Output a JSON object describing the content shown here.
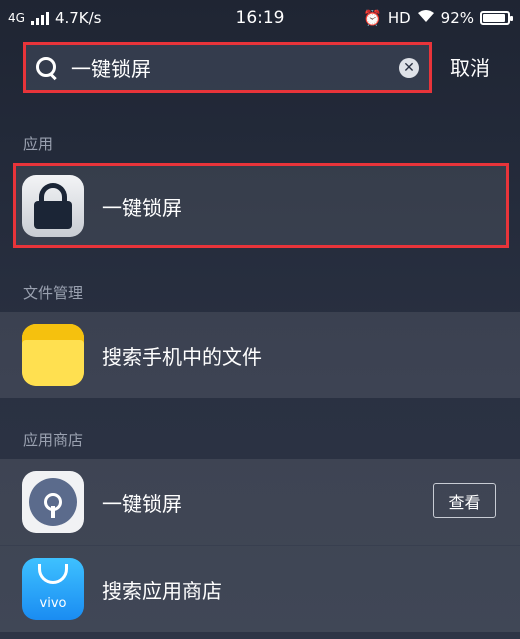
{
  "status_bar": {
    "network_type": "4G",
    "speed": "4.7K/s",
    "time": "16:19",
    "hd_label": "HD",
    "battery_percent": "92%",
    "battery_level": 0.92
  },
  "search": {
    "query": "一键锁屏",
    "cancel_label": "取消"
  },
  "sections": {
    "apps": {
      "header": "应用",
      "item_label": "一键锁屏"
    },
    "files": {
      "header": "文件管理",
      "item_label": "搜索手机中的文件"
    },
    "store": {
      "header": "应用商店",
      "item1_label": "一键锁屏",
      "item1_button": "查看",
      "item2_label": "搜索应用商店",
      "vivo_logo_text": "vivo"
    }
  },
  "colors": {
    "highlight": "#e8343a",
    "background": "#242b3b"
  },
  "icons": {
    "search": "search-icon",
    "clear": "clear-icon",
    "lock_app": "lock-app-icon",
    "folder": "folder-icon",
    "store_lock": "store-lock-app-icon",
    "vivo_store": "vivo-store-icon"
  }
}
